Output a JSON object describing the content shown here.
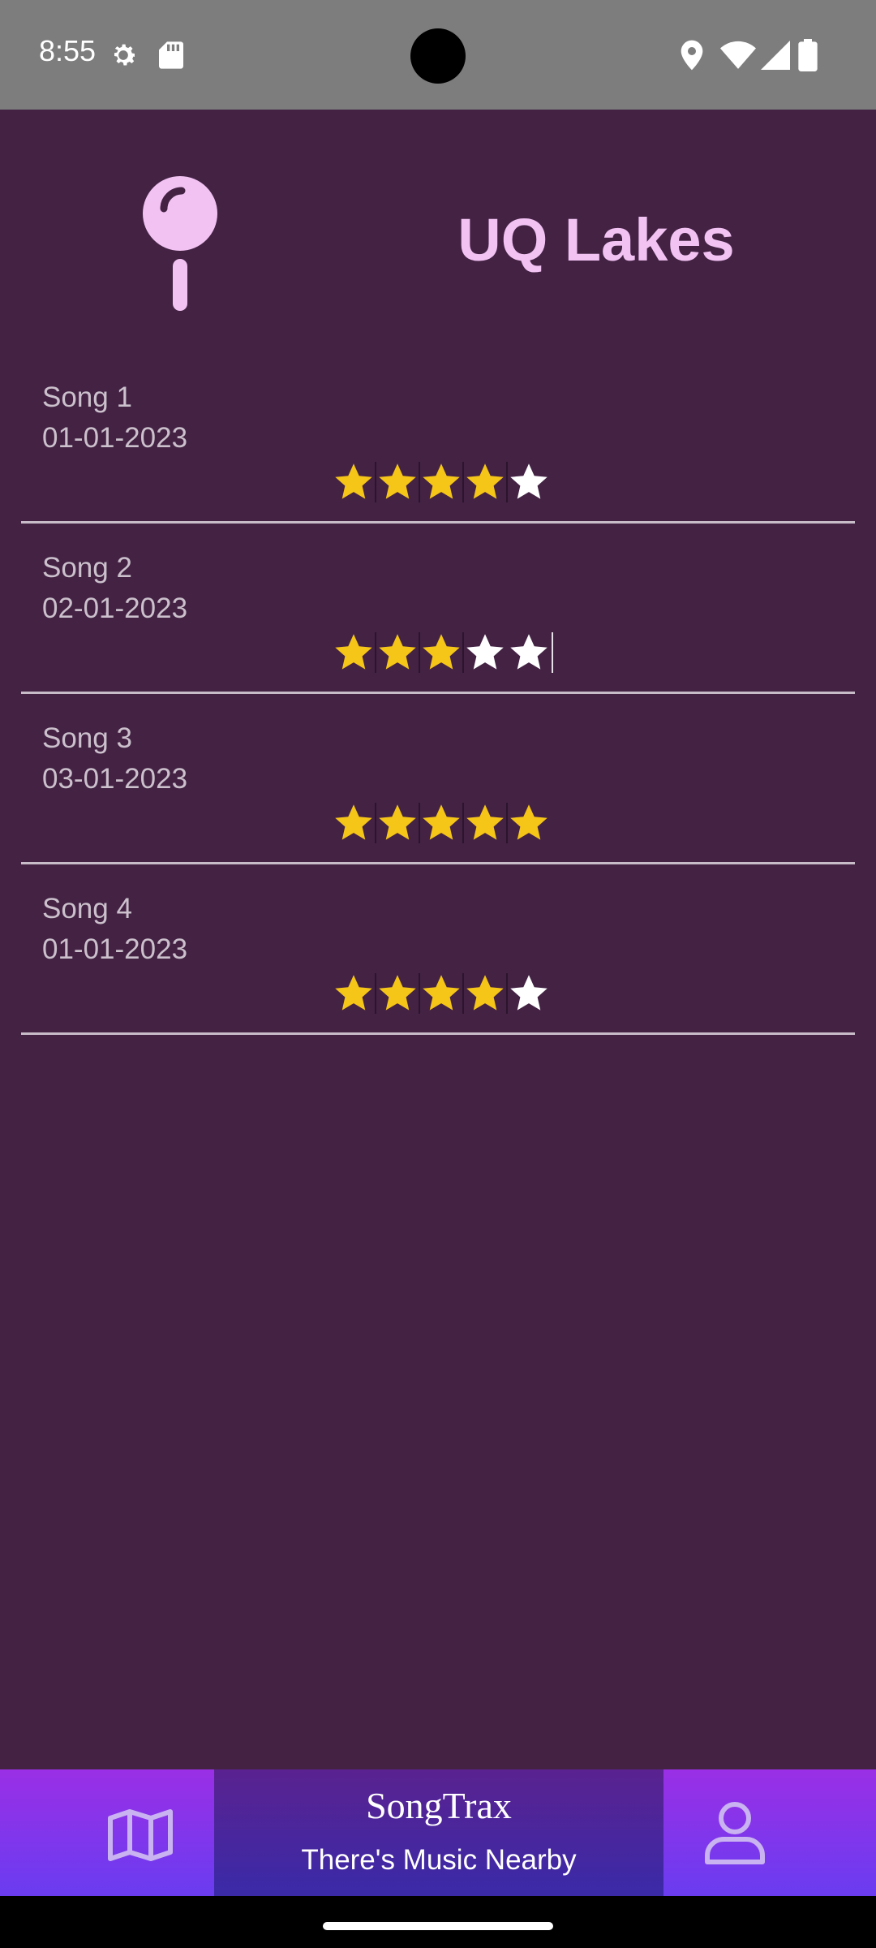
{
  "status_bar": {
    "time": "8:55",
    "icons": [
      "settings-gear-icon",
      "sd-card-icon",
      "location-icon",
      "wifi-icon",
      "cell-signal-icon",
      "battery-icon"
    ]
  },
  "header": {
    "icon": "map-pin-icon",
    "location_name": "UQ Lakes"
  },
  "songs": [
    {
      "name": "Song 1",
      "date": "01-01-2023",
      "rating": 4
    },
    {
      "name": "Song 2",
      "date": "02-01-2023",
      "rating": 3
    },
    {
      "name": "Song 3",
      "date": "03-01-2023",
      "rating": 5
    },
    {
      "name": "Song 4",
      "date": "01-01-2023",
      "rating": 4
    }
  ],
  "rating_max": 5,
  "bottom_bar": {
    "left_icon": "map-icon",
    "title": "SongTrax",
    "subtitle": "There's Music Nearby",
    "right_icon": "profile-icon"
  },
  "colors": {
    "background": "#432244",
    "accent_text": "#f2c3f2",
    "star_filled": "#f5c518",
    "star_empty": "#ffffff"
  }
}
